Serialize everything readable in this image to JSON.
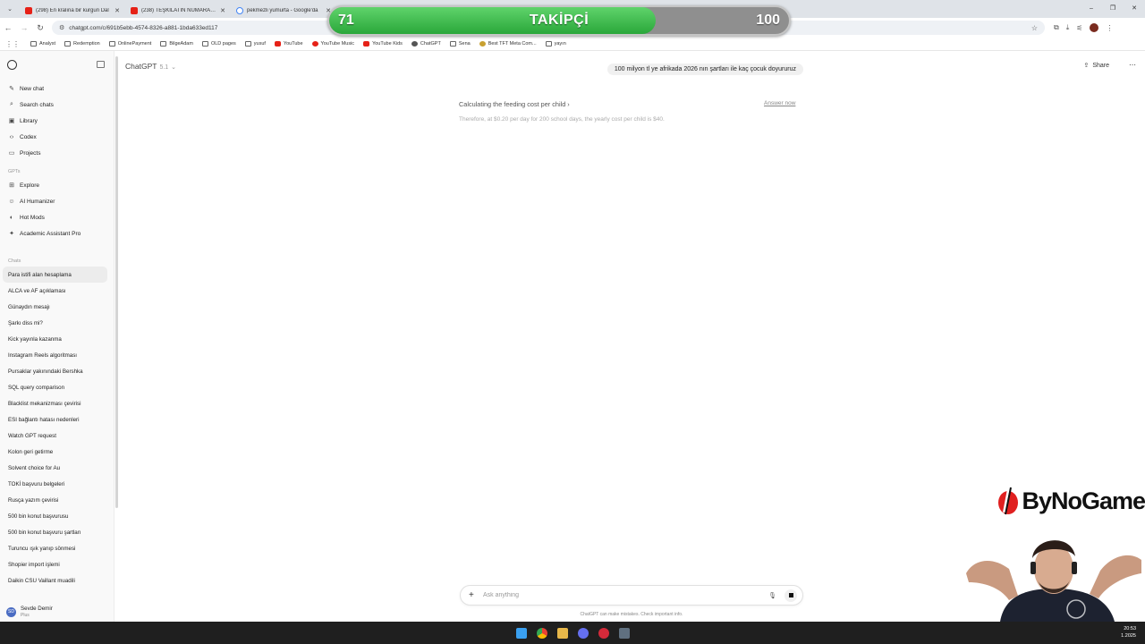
{
  "browser": {
    "tabs": [
      {
        "title": "(298) En kralına bir kurgun Dal",
        "favicon": "youtube-icon",
        "active": false
      },
      {
        "title": "(238) TEŞKİLATIN NUMARASI!",
        "favicon": "youtube-icon",
        "active": false
      },
      {
        "title": "pekmezli yumurta - Google'da",
        "favicon": "google-icon",
        "active": false
      }
    ],
    "url": "chatgpt.com/c/691b5ebb-4574-8326-a881-1bda633ed117",
    "bookmarks": [
      "Analyst",
      "Redemption",
      "OnlinePayment",
      "BilgeAdam",
      "OLD pages",
      "yusuf",
      "YouTube",
      "YouTube Music",
      "YouTube Kids",
      "ChatGPT",
      "Sena",
      "Best TFT Meta Com...",
      "yayın"
    ],
    "window_controls": [
      "–",
      "❐",
      "✕"
    ]
  },
  "sidebar": {
    "nav": [
      {
        "label": "New chat",
        "icon": "edit-icon"
      },
      {
        "label": "Search chats",
        "icon": "search-icon"
      },
      {
        "label": "Library",
        "icon": "library-icon"
      },
      {
        "label": "Codex",
        "icon": "code-icon"
      },
      {
        "label": "Projects",
        "icon": "folder-icon"
      }
    ],
    "gpts_heading": "GPTs",
    "gpts": [
      {
        "label": "Explore",
        "icon": "grid-icon"
      },
      {
        "label": "AI Humanizer",
        "icon": "humanizer-icon"
      },
      {
        "label": "Hot Mods",
        "icon": "hot-mods-icon"
      },
      {
        "label": "Academic Assistant Pro",
        "icon": "academic-icon"
      }
    ],
    "chats_heading": "Chats",
    "chats": [
      "Para istifi alan hesaplama",
      "ALCA ve AF açıklaması",
      "Günaydın mesajı",
      "Şarkı diss mi?",
      "Kick yayınla kazanma",
      "Instagram Reels algoritması",
      "Pursaklar yakınındaki Bershka",
      "SQL query comparison",
      "Blacklist mekanizması çevirisi",
      "ESI bağlantı hatası nedenleri",
      "Watch GPT request",
      "Kolon geri getirme",
      "Solvent choice for Au",
      "TOKİ başvuru belgeleri",
      "Rusça yazım çevirisi",
      "500 bin konut başvurusu",
      "500 bin konut başvuru şartları",
      "Turuncu ışık yanıp sönmesi",
      "Shopier import işlemi",
      "Daikin CSU Vaillant muadili"
    ],
    "user": {
      "initials": "SD",
      "name": "Sevde Demir",
      "plan": "Plus"
    }
  },
  "main": {
    "model_name": "ChatGPT",
    "model_version": "5.1",
    "share_label": "Share",
    "more_label": "⋯",
    "user_message": "100 milyon tl ye afrikada 2026 nın şartları ile kaç çocuk doyururuz",
    "thinking_title": "Calculating the feeding cost per child",
    "thinking_detail": "Therefore, at $0.20 per day for 200 school days, the yearly cost per child is $40.",
    "answer_now_label": "Answer now",
    "composer_placeholder": "Ask anything",
    "disclaimer": "ChatGPT can make mistakes. Check important info."
  },
  "overlay": {
    "follower_current": "71",
    "follower_label": "TAKİPÇİ",
    "follower_goal": "100",
    "follower_progress": 0.71,
    "sponsor": "ByNoGame",
    "colors": {
      "bar_fill": "#2aa73a",
      "bar_track": "#8f8f8f"
    }
  },
  "taskbar": {
    "time": "20:53",
    "date": "1.2025"
  }
}
